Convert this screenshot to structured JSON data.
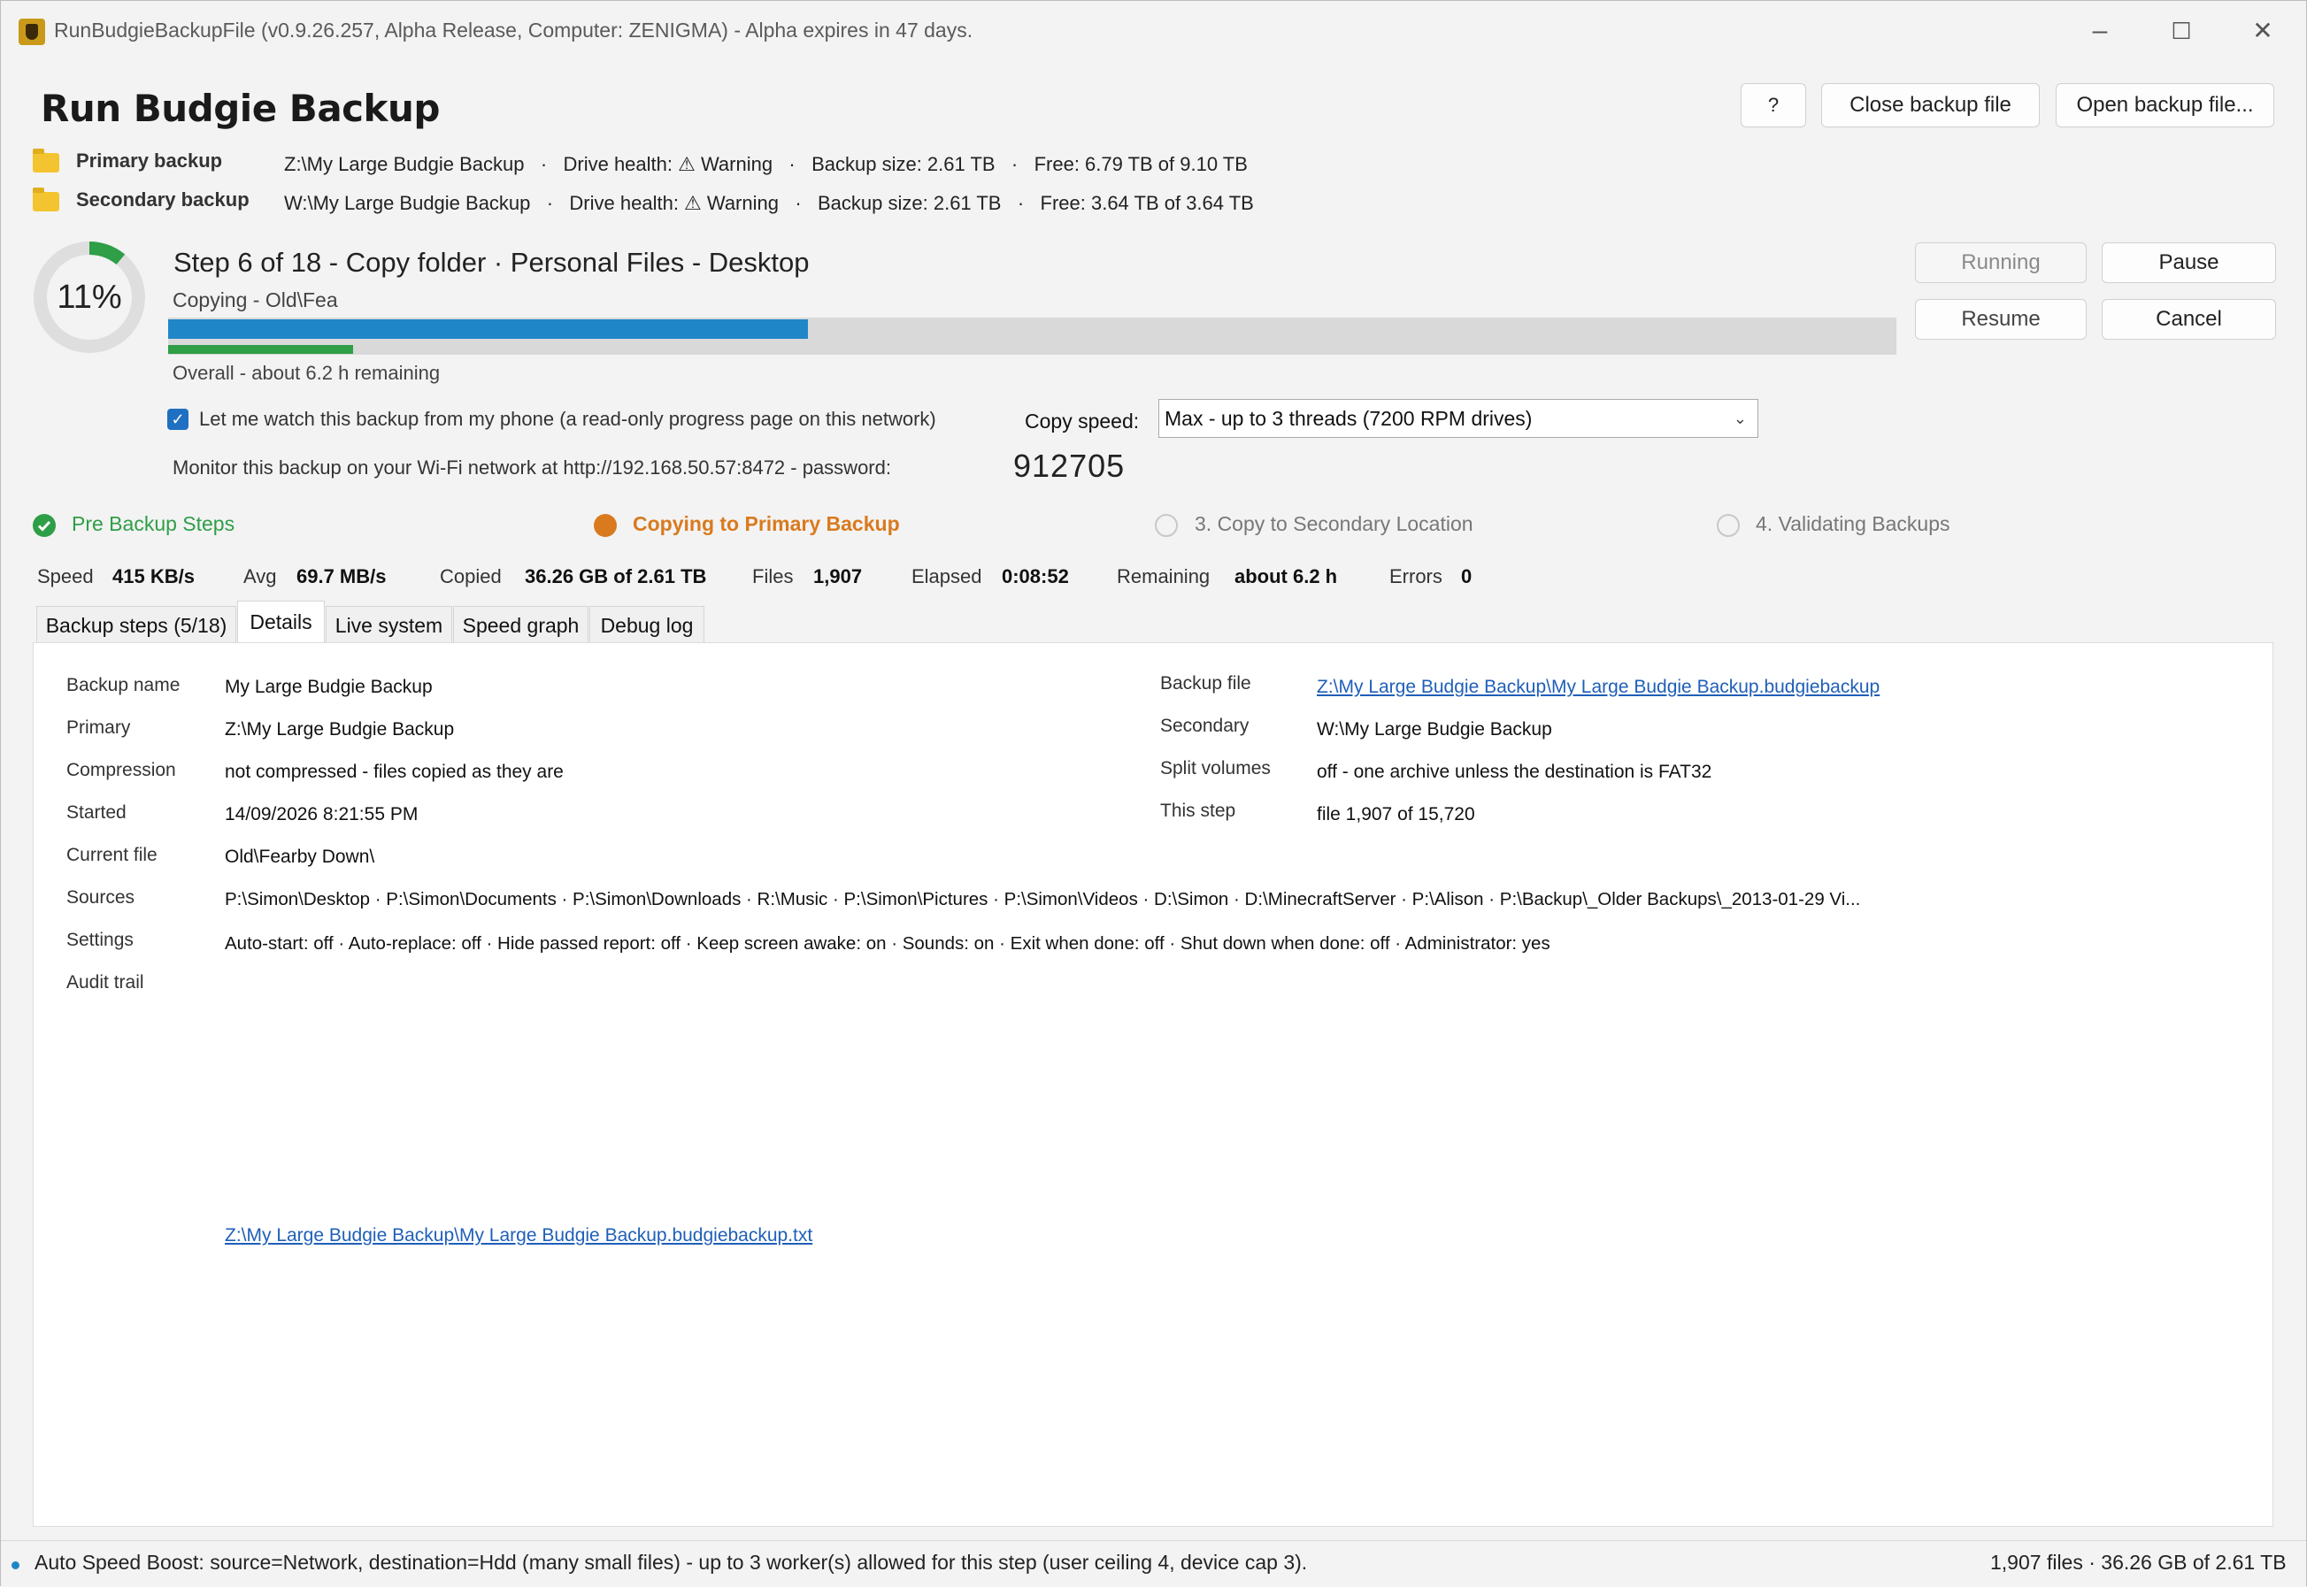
{
  "window": {
    "title": "RunBudgieBackupFile (v0.9.26.257, Alpha Release, Computer: ZENIGMA) - Alpha expires in 47 days.",
    "minimize": "–",
    "maximize": "☐",
    "close": "✕"
  },
  "header": {
    "title": "Run Budgie Backup",
    "help_icon": "?",
    "close_backup": "Close backup file",
    "open_backup": "Open backup file..."
  },
  "drives": {
    "primary": {
      "label": "Primary backup",
      "path": "Z:\\My Large Budgie Backup",
      "health": "Drive health: ⚠ Warning",
      "size": "Backup size: 2.61 TB",
      "free": "Free: 6.79 TB of 9.10 TB"
    },
    "secondary": {
      "label": "Secondary backup",
      "path": "W:\\My Large Budgie Backup",
      "health": "Drive health: ⚠ Warning",
      "size": "Backup size: 2.61 TB",
      "free": "Free: 3.64 TB of 3.64 TB"
    },
    "separator": "·"
  },
  "progress": {
    "percent_label": "11%",
    "percent": 11,
    "step_title": "Step 6 of 18 - Copy folder · Personal Files - Desktop",
    "step_sub": "Copying - Old\\Fea",
    "step_fraction": 0.37,
    "overall_fraction": 0.107,
    "overall": "Overall - about 6.2 h remaining"
  },
  "controls": {
    "running": "Running",
    "pause": "Pause",
    "resume": "Resume",
    "cancel": "Cancel"
  },
  "remote": {
    "checkbox_label": "Let me watch this backup from my phone (a read-only progress page on this network)",
    "checked": true,
    "copy_speed_label": "Copy speed:",
    "copy_speed_value": "Max - up to 3 threads (7200 RPM drives)",
    "monitor_text": "Monitor this backup on your Wi-Fi network at  http://192.168.50.57:8472  -  password:",
    "password": "912705"
  },
  "phases": [
    {
      "label": "Pre Backup Steps",
      "state": "done",
      "color": "#2e9e47"
    },
    {
      "label": "Copying to Primary Backup",
      "state": "active",
      "color": "#d97a1e"
    },
    {
      "label": "3. Copy to Secondary Location",
      "state": "pending",
      "color": "#777777"
    },
    {
      "label": "4. Validating Backups",
      "state": "pending",
      "color": "#777777"
    }
  ],
  "stats": {
    "speed_label": "Speed",
    "speed": "415 KB/s",
    "avg_label": "Avg",
    "avg": "69.7 MB/s",
    "copied_label": "Copied",
    "copied": "36.26 GB of 2.61 TB",
    "files_label": "Files",
    "files": "1,907",
    "elapsed_label": "Elapsed",
    "elapsed": "0:08:52",
    "remaining_label": "Remaining",
    "remaining": "about 6.2 h",
    "errors_label": "Errors",
    "errors": "0"
  },
  "tabs": [
    "Backup steps (5/18)",
    "Details",
    "Live system",
    "Speed graph",
    "Debug log"
  ],
  "details": {
    "backup_name_k": "Backup name",
    "backup_name": "My Large Budgie Backup",
    "primary_k": "Primary",
    "primary": "Z:\\My Large Budgie Backup",
    "compression_k": "Compression",
    "compression": "not compressed - files copied as they are",
    "started_k": "Started",
    "started": "14/09/2026 8:21:55 PM",
    "current_file_k": "Current file",
    "current_file": "Old\\Fearby Down\\",
    "sources_k": "Sources",
    "sources": "P:\\Simon\\Desktop  ·  P:\\Simon\\Documents  ·  P:\\Simon\\Downloads  ·  R:\\Music  ·  P:\\Simon\\Pictures  ·  P:\\Simon\\Videos  ·  D:\\Simon  ·  D:\\MinecraftServer  ·  P:\\Alison  ·  P:\\Backup\\_Older Backups\\_2013-01-29 Vi...",
    "settings_k": "Settings",
    "settings": "Auto-start: off  ·  Auto-replace: off  ·  Hide passed report: off  ·  Keep screen awake: on  ·  Sounds: on  ·  Exit when done: off  ·  Shut down when done: off  ·  Administrator: yes",
    "audit_k": "Audit trail",
    "audit_link": "Z:\\My Large Budgie Backup\\My Large Budgie Backup.budgiebackup.txt",
    "backup_file_k": "Backup file",
    "backup_file": "Z:\\My Large Budgie Backup\\My Large Budgie Backup.budgiebackup",
    "secondary_k": "Secondary",
    "secondary": "W:\\My Large Budgie Backup",
    "split_k": "Split volumes",
    "split": "off - one archive unless the destination is FAT32",
    "this_step_k": "This step",
    "this_step": "file 1,907 of 15,720"
  },
  "status": {
    "left": "Auto Speed Boost: source=Network, destination=Hdd (many small files) - up to 3 worker(s) allowed for this step (user ceiling 4, device cap 3).",
    "right": "1,907 files · 36.26 GB of 2.61 TB"
  }
}
